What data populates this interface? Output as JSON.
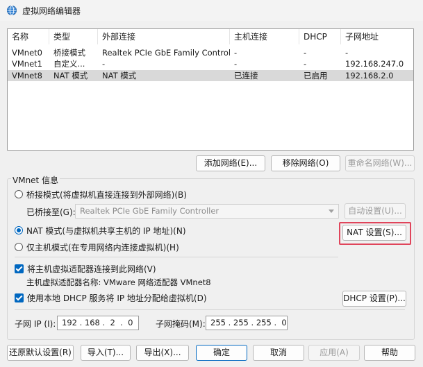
{
  "window": {
    "title": "虚拟网络编辑器",
    "icon": "globe-icon"
  },
  "network_table": {
    "columns": [
      "名称",
      "类型",
      "外部连接",
      "主机连接",
      "DHCP",
      "子网地址"
    ],
    "rows": [
      {
        "name": "VMnet0",
        "type": "桥接模式",
        "external": "Realtek PCIe GbE Family Controller",
        "host": "-",
        "dhcp": "-",
        "subnet": "-"
      },
      {
        "name": "VMnet1",
        "type": "自定义...",
        "external": "-",
        "host": "-",
        "dhcp": "-",
        "subnet": "192.168.247.0"
      },
      {
        "name": "VMnet8",
        "type": "NAT 模式",
        "external": "NAT 模式",
        "host": "已连接",
        "dhcp": "已启用",
        "subnet": "192.168.2.0"
      }
    ]
  },
  "table_buttons": {
    "add": "添加网络(E)...",
    "remove": "移除网络(O)",
    "rename": "重命名网络(W)..."
  },
  "vmnet_info": {
    "label": "VMnet 信息",
    "bridge_radio": "桥接模式(将虚拟机直接连接到外部网络)(B)",
    "bridged_to_label": "已桥接至(G):",
    "bridged_to_value": "Realtek PCIe GbE Family Controller",
    "auto_settings": "自动设置(U)...",
    "nat_radio": "NAT 模式(与虚拟机共享主机的 IP 地址)(N)",
    "nat_settings": "NAT 设置(S)...",
    "hostonly_radio": "仅主机模式(在专用网络内连接虚拟机)(H)",
    "connect_adapter": "将主机虚拟适配器连接到此网络(V)",
    "adapter_name": "主机虚拟适配器名称: VMware 网络适配器 VMnet8",
    "use_dhcp": "使用本地 DHCP 服务将 IP 地址分配给虚拟机(D)",
    "dhcp_settings": "DHCP 设置(P)...",
    "subnet_ip_label": "子网 IP (I):",
    "subnet_ip_value": "192 . 168 .  2  .  0",
    "subnet_mask_label": "子网掩码(M):",
    "subnet_mask_value": "255 . 255 . 255 .  0"
  },
  "footer": {
    "restore": "还原默认设置(R)",
    "import": "导入(T)...",
    "export": "导出(X)...",
    "ok": "确定",
    "cancel": "取消",
    "apply": "应用(A)",
    "help": "帮助"
  },
  "colors": {
    "accent": "#0067c0",
    "highlight": "#e0455b",
    "selection": "#d9d9d9"
  }
}
